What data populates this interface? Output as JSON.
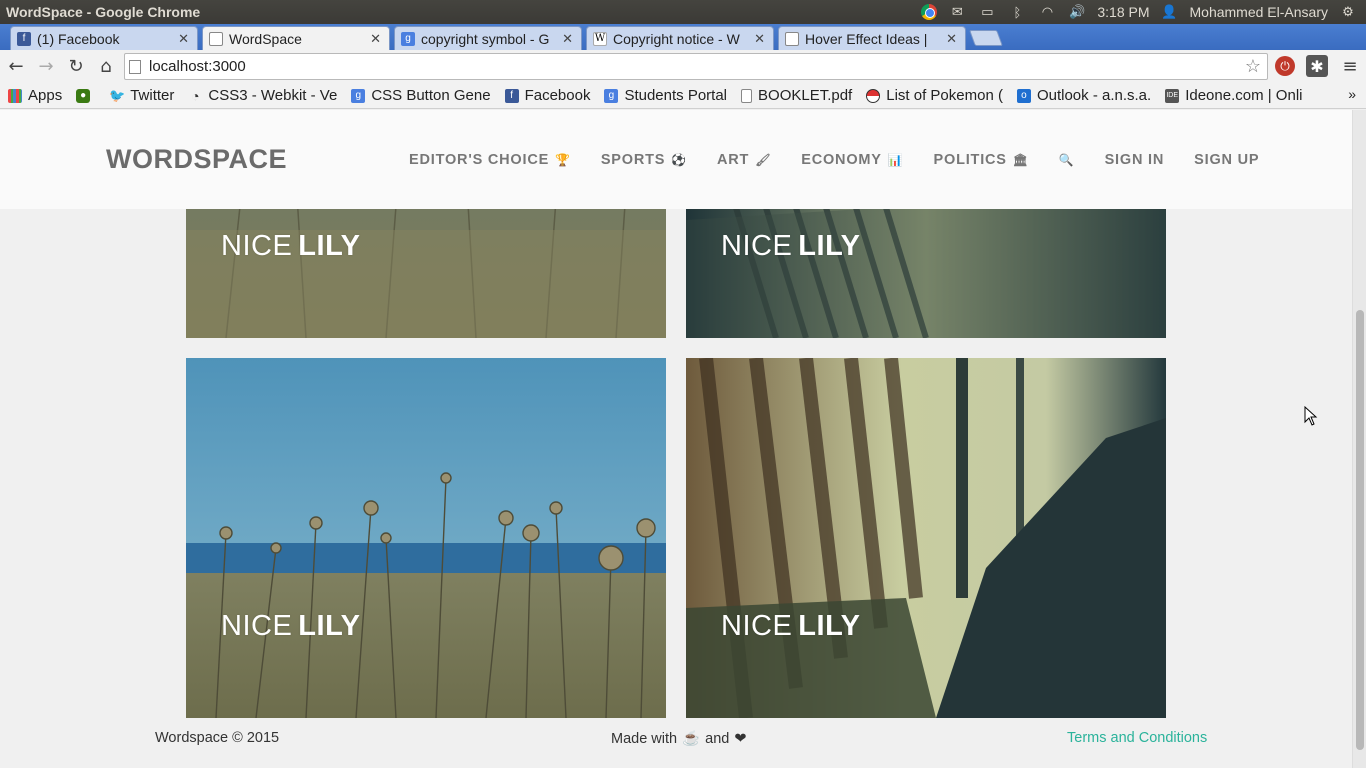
{
  "os": {
    "window_title": "WordSpace - Google Chrome",
    "clock": "3:18 PM",
    "user": "Mohammed El-Ansary"
  },
  "tabs": [
    {
      "label": "(1) Facebook",
      "icon": "facebook-icon",
      "color": "#3b5998"
    },
    {
      "label": "WordSpace",
      "icon": "page-icon",
      "color": "#ffffff",
      "active": true
    },
    {
      "label": "copyright symbol - G",
      "icon": "google-icon",
      "color": "#4a7fe0"
    },
    {
      "label": "Copyright notice - W",
      "icon": "wikipedia-icon",
      "color": "#ffffff"
    },
    {
      "label": "Hover Effect Ideas |",
      "icon": "page-icon",
      "color": "#ffffff"
    }
  ],
  "toolbar": {
    "url": "localhost:3000"
  },
  "bookmarks": [
    {
      "label": "Apps",
      "icon": "apps-icon",
      "color": "#e44"
    },
    {
      "label": "",
      "icon": "green-ext-icon",
      "color": "#3a7a12"
    },
    {
      "label": "Twitter",
      "icon": "twitter-icon",
      "color": "#55acee"
    },
    {
      "label": "CSS3 - Webkit - Ve",
      "icon": "css3-icon",
      "color": "#333"
    },
    {
      "label": "CSS Button Gene",
      "icon": "google-icon",
      "color": "#4a7fe0"
    },
    {
      "label": "Facebook",
      "icon": "facebook-icon",
      "color": "#3b5998"
    },
    {
      "label": "Students Portal",
      "icon": "google-icon",
      "color": "#4a7fe0"
    },
    {
      "label": "BOOKLET.pdf",
      "icon": "page-icon",
      "color": "#ffffff"
    },
    {
      "label": "List of Pokemon (",
      "icon": "pokeball-icon",
      "color": "#d33"
    },
    {
      "label": "Outlook - a.n.s.a.",
      "icon": "outlook-icon",
      "color": "#1f6fd0"
    },
    {
      "label": "Ideone.com | Onli",
      "icon": "ideone-icon",
      "color": "#555"
    }
  ],
  "site": {
    "logo": "WORDSPACE",
    "menu": [
      {
        "label": "EDITOR'S CHOICE",
        "icon": "trophy-icon",
        "glyph": "🏆"
      },
      {
        "label": "SPORTS",
        "icon": "soccer-ball-icon",
        "glyph": "⚽"
      },
      {
        "label": "ART",
        "icon": "paintbrush-icon",
        "glyph": "🖌"
      },
      {
        "label": "ECONOMY",
        "icon": "bar-chart-icon",
        "glyph": "📊"
      },
      {
        "label": "POLITICS",
        "icon": "institution-icon",
        "glyph": "🏛"
      },
      {
        "label": "",
        "icon": "search-icon",
        "glyph": "🔍"
      },
      {
        "label": "SIGN IN",
        "icon": "",
        "glyph": ""
      },
      {
        "label": "SIGN UP",
        "icon": "",
        "glyph": ""
      }
    ],
    "cards": [
      {
        "light": "NICE",
        "bold": "LILY",
        "scene": "flowers"
      },
      {
        "light": "NICE",
        "bold": "LILY",
        "scene": "seats"
      },
      {
        "light": "NICE",
        "bold": "LILY",
        "scene": "flowers-sky"
      },
      {
        "light": "NICE",
        "bold": "LILY",
        "scene": "seats"
      }
    ],
    "footer": {
      "copyright": "Wordspace © 2015",
      "made_with": "Made with",
      "and": "and",
      "terms": "Terms and Conditions",
      "link_color": "#2bb39b"
    }
  }
}
